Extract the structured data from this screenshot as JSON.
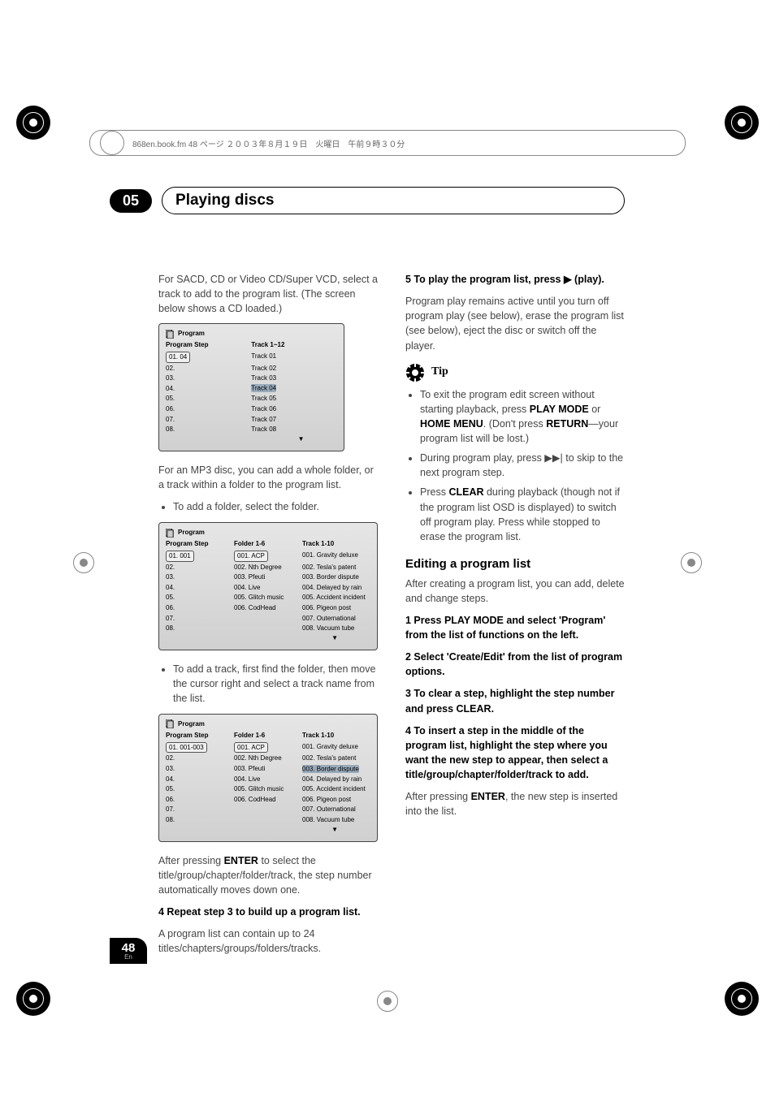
{
  "binder_text": "868en.book.fm  48 ページ  ２００３年８月１９日　火曜日　午前９時３０分",
  "chapter_number": "05",
  "chapter_title": "Playing discs",
  "page_number": "48",
  "page_lang": "En",
  "left": {
    "intro": "For SACD, CD or Video CD/Super VCD, select a track to add to the program list. (The screen below shows a CD loaded.)",
    "box1": {
      "title": "Program",
      "h1": "Program Step",
      "h2": "Track 1~12",
      "rows": [
        [
          "01. 04",
          "Track 01"
        ],
        [
          "02.",
          "Track 02"
        ],
        [
          "03.",
          "Track 03"
        ],
        [
          "04.",
          "Track 04"
        ],
        [
          "05.",
          "Track 05"
        ],
        [
          "06.",
          "Track 06"
        ],
        [
          "07.",
          "Track 07"
        ],
        [
          "08.",
          "Track 08"
        ]
      ]
    },
    "mp3_line": "For an MP3 disc, you can add a whole folder, or a track within a folder to the program list.",
    "bullet1": "To add a folder, select the folder.",
    "box2": {
      "title": "Program",
      "h1": "Program Step",
      "h2": "Folder 1-6",
      "h3": "Track 1-10",
      "rows": [
        [
          "01. 001",
          "001. ACP",
          "001. Gravity deluxe"
        ],
        [
          "02.",
          "002. Nth Degree",
          "002. Tesla's patent"
        ],
        [
          "03.",
          "003. Pfeuti",
          "003. Border dispute"
        ],
        [
          "04.",
          "004. Live",
          "004. Delayed by rain"
        ],
        [
          "05.",
          "005. Glitch music",
          "005. Accident incident"
        ],
        [
          "06.",
          "006. CodHead",
          "006. Pigeon post"
        ],
        [
          "07.",
          "",
          "007. Outernational"
        ],
        [
          "08.",
          "",
          "008. Vacuum tube"
        ]
      ]
    },
    "bullet2": "To add a track, first find the folder, then move the cursor right and select a track name from the list.",
    "box3": {
      "title": "Program",
      "h1": "Program Step",
      "h2": "Folder 1-6",
      "h3": "Track 1-10",
      "rows": [
        [
          "01. 001-003",
          "001. ACP",
          "001. Gravity deluxe"
        ],
        [
          "02.",
          "002. Nth Degree",
          "002. Tesla's patent"
        ],
        [
          "03.",
          "003. Pfeuti",
          "003. Border dispute"
        ],
        [
          "04.",
          "004. Live",
          "004. Delayed by rain"
        ],
        [
          "05.",
          "005. Glitch music",
          "005. Accident incident"
        ],
        [
          "06.",
          "006. CodHead",
          "006. Pigeon post"
        ],
        [
          "07.",
          "",
          "007. Outernational"
        ],
        [
          "08.",
          "",
          "008. Vacuum tube"
        ]
      ]
    },
    "after_enter1": "After pressing ",
    "after_enter_bold": "ENTER",
    "after_enter2": " to select the title/group/chapter/folder/track, the step number automatically moves down one.",
    "step4_head": "4    Repeat step 3 to build up a program list.",
    "step4_body": "A program list can contain up to 24 titles/chapters/groups/folders/tracks."
  },
  "right": {
    "step5_head": "5    To play the program list, press ▶ (play).",
    "step5_body": "Program play remains active until you turn off program play (see below), erase the program list (see below), eject the disc or switch off the player.",
    "tip_label": "Tip",
    "tip1a": "To exit the program edit screen without starting playback, press ",
    "tip1b": "PLAY MODE",
    "tip1c": " or ",
    "tip1d": "HOME MENU",
    "tip1e": ". (Don't press ",
    "tip1f": "RETURN",
    "tip1g": "—your program list will be lost.)",
    "tip2": "During program play, press ▶▶| to skip to the next program step.",
    "tip3a": "Press ",
    "tip3b": "CLEAR",
    "tip3c": " during playback (though not if the program list OSD is displayed) to switch off program play. Press while stopped to erase the program list.",
    "edit_heading": "Editing a program list",
    "edit_intro": "After creating a program list, you can add, delete and change steps.",
    "e1": "1    Press PLAY MODE and select 'Program' from the list of functions on the left.",
    "e2": "2    Select 'Create/Edit' from the list of program options.",
    "e3": "3    To clear a step, highlight the step number and press CLEAR.",
    "e4": "4    To insert a step in the middle of the program list, highlight the step where you want the new step to appear, then select a title/group/chapter/folder/track to add.",
    "e4_after1": "After pressing ",
    "e4_after_bold": "ENTER",
    "e4_after2": ", the new step is inserted into the list."
  }
}
